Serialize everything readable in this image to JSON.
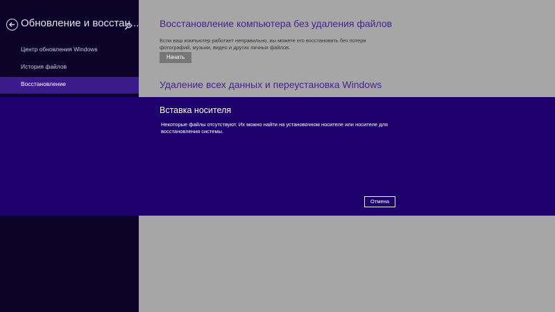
{
  "colors": {
    "sidebar_bg": "#0c0328",
    "sidebar_selected": "#3b1a8c",
    "main_bg": "#a6a6a6",
    "accent_title": "#43238f",
    "modal_bg": "#1d006b"
  },
  "sidebar": {
    "title": "Обновление и восстан...",
    "back_icon": "back-arrow-icon",
    "search_icon": "search-icon",
    "items": [
      {
        "label": "Центр обновления Windows",
        "selected": false
      },
      {
        "label": "История файлов",
        "selected": false
      },
      {
        "label": "Восстановление",
        "selected": true
      }
    ]
  },
  "main": {
    "refresh": {
      "title": "Восстановление компьютера без удаления файлов",
      "description": "Если ваш компьютер работает неправильно, вы можете его восстановить без потери фотографий, музыки, видео и других личных файлов.",
      "button_label": "Начать"
    },
    "reset": {
      "title": "Удаление всех данных и переустановка Windows"
    }
  },
  "dialog": {
    "title": "Вставка носителя",
    "message": "Некоторые файлы отсутствуют. Их можно найти на установочном носителе или носителе для восстановления системы.",
    "cancel_label": "Отмена"
  }
}
